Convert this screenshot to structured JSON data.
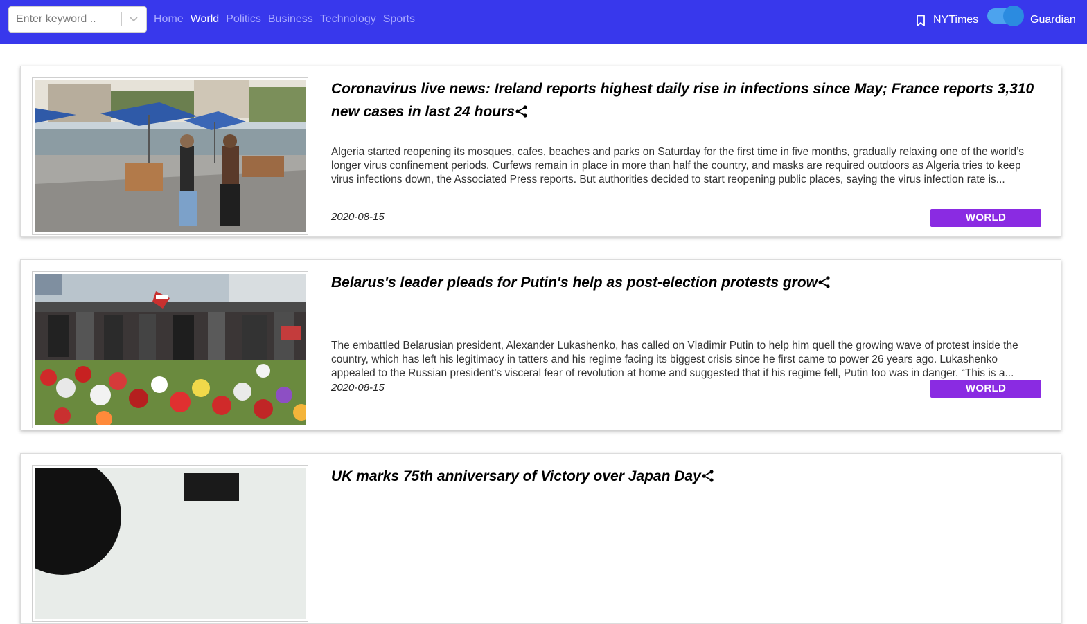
{
  "search": {
    "placeholder": "Enter keyword .."
  },
  "nav": {
    "links": [
      "Home",
      "World",
      "Politics",
      "Business",
      "Technology",
      "Sports"
    ],
    "active": "World"
  },
  "source_toggle": {
    "left_label": "NYTimes",
    "right_label": "Guardian",
    "selected": "Guardian"
  },
  "colors": {
    "navbar": "#3838ec",
    "badge": "#8a2be2",
    "toggle": "#4ca3ee"
  },
  "articles": [
    {
      "title": "Coronavirus live news: Ireland reports highest daily rise in infections since May; France reports 3,310 new cases in last 24 hours",
      "description": "Algeria started reopening its mosques, cafes, beaches and parks on Saturday for the first time in five months, gradually relaxing one of the world’s longer virus confinement periods. Curfews remain in place in more than half the country, and masks are required outdoors as Algeria tries to keep virus infections down, the Associated Press reports. But authorities decided to start reopening public places, saying the virus infection rate is...",
      "date": "2020-08-15",
      "section": "WORLD"
    },
    {
      "title": "Belarus's leader pleads for Putin's help as post-election protests grow",
      "description": "The embattled Belarusian president, Alexander Lukashenko, has called on Vladimir Putin to help him quell the growing wave of protest inside the country, which has left his legitimacy in tatters and his regime facing its biggest crisis since he first came to power 26 years ago. Lukashenko appealed to the Russian president’s visceral fear of revolution at home and suggested that if his regime fell, Putin too was in danger. “This is a...",
      "date": "2020-08-15",
      "section": "WORLD"
    },
    {
      "title": "UK marks 75th anniversary of Victory over Japan Day",
      "description": "",
      "date": "",
      "section": ""
    }
  ]
}
